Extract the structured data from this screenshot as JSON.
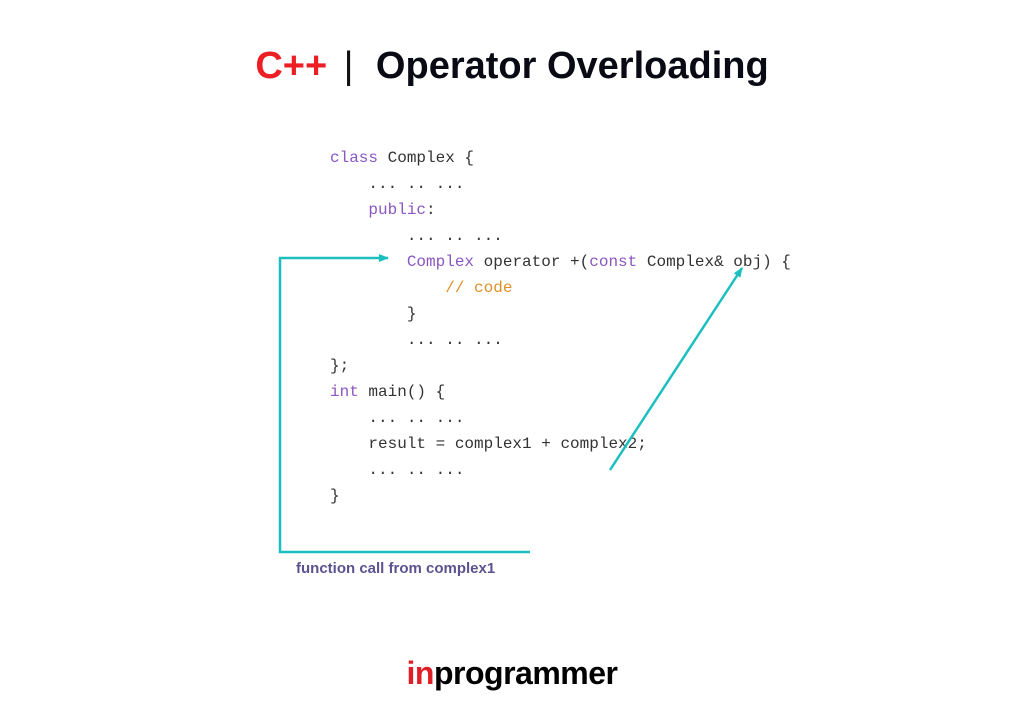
{
  "title": {
    "prefix": "C++",
    "separator": "|",
    "main": "Operator Overloading"
  },
  "code": {
    "line1_class": "class",
    "line1_rest": " Complex {",
    "line2": "    ... .. ...",
    "line3_indent": "    ",
    "line3_public": "public",
    "line3_colon": ":",
    "line4": "        ... .. ...",
    "line5_indent": "        ",
    "line5_type": "Complex",
    "line5_op": " operator +(",
    "line5_const": "const",
    "line5_rest": " Complex& obj) {",
    "line6_indent": "            ",
    "line6_comment": "// code",
    "line7": "        }",
    "line8": "        ... .. ...",
    "line9": "};",
    "line10": "",
    "line11_int": "int",
    "line11_rest": " main() {",
    "line12": "    ... .. ...",
    "line13": "    result = complex1 + complex2;",
    "line14": "    ... .. ...",
    "line15": "}"
  },
  "annotation": "function call from complex1",
  "footer": {
    "in": "in",
    "programmer": "programmer"
  },
  "colors": {
    "accent_red": "#ee1e25",
    "arrow_teal": "#1bbfbf",
    "annotation_purple": "#5a5390",
    "keyword_purple": "#8a56c2",
    "comment_orange": "#e09028"
  }
}
